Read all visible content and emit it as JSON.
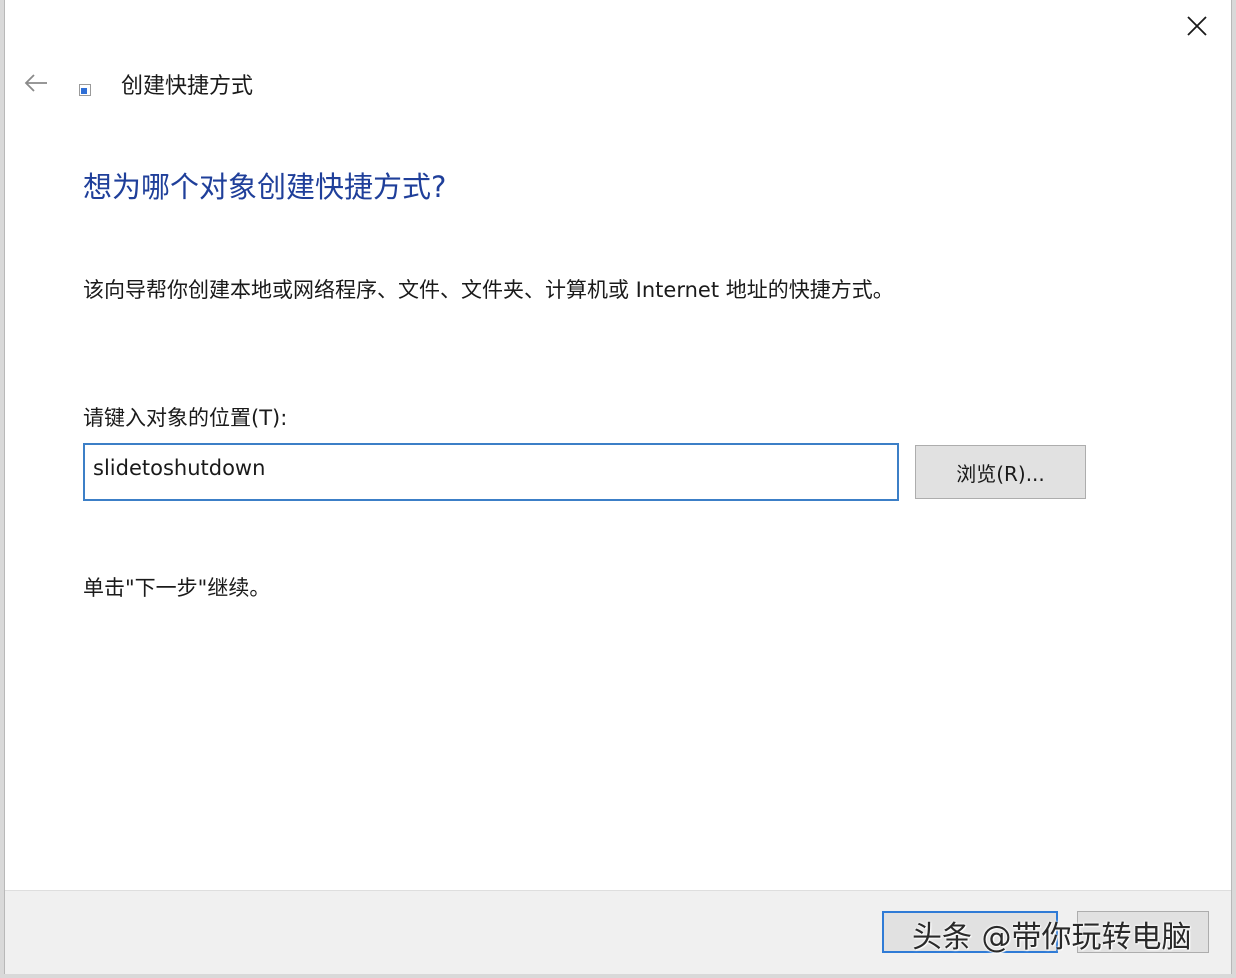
{
  "window": {
    "title": "创建快捷方式"
  },
  "content": {
    "heading": "想为哪个对象创建快捷方式?",
    "description": "该向导帮你创建本地或网络程序、文件、文件夹、计算机或 Internet 地址的快捷方式。",
    "location_label": "请键入对象的位置(T):",
    "location_value": "slidetoshutdown",
    "browse_label": "浏览(R)...",
    "continue_hint": "单击\"下一步\"继续。"
  },
  "footer": {
    "next_label": "",
    "cancel_label": ""
  },
  "watermark": {
    "text": "头条 @带你玩转电脑"
  },
  "icons": {
    "close": "close-icon",
    "back": "back-arrow-icon",
    "app": "shortcut-icon"
  },
  "colors": {
    "heading": "#1f3f9a",
    "input_border": "#3c7fc7",
    "footer_bg": "#f0f0f0",
    "button_bg": "#e1e1e1"
  }
}
